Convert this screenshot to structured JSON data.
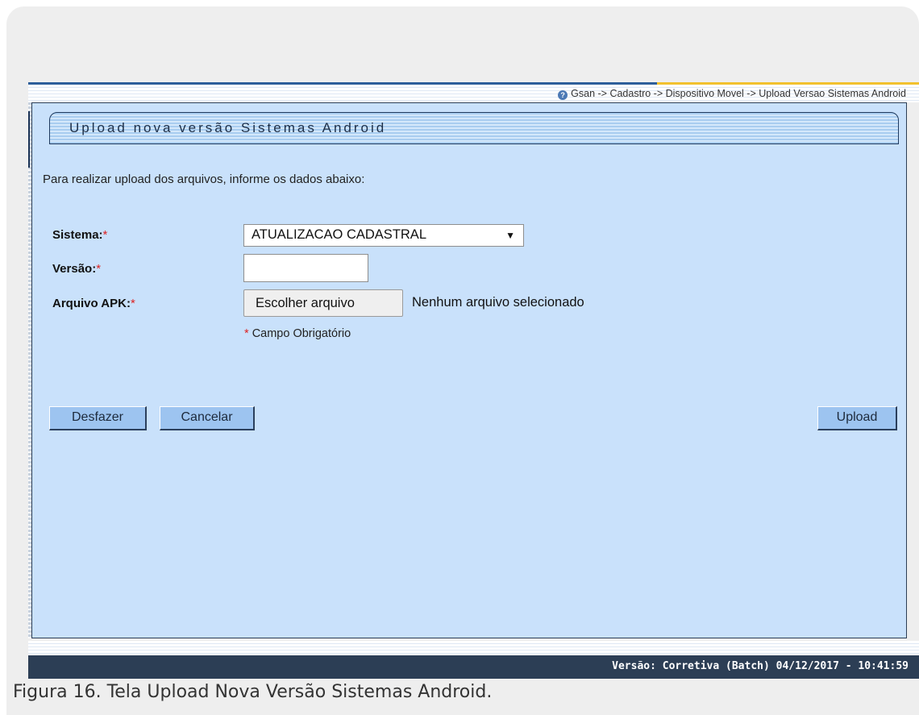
{
  "breadcrumb": "Gsan -> Cadastro -> Dispositivo Movel -> Upload Versao Sistemas Android",
  "page_title": "Upload nova versão Sistemas Android",
  "intro_text": "Para realizar upload dos arquivos, informe os dados abaixo:",
  "form": {
    "sistema_label": "Sistema:",
    "sistema_value": "ATUALIZACAO CADASTRAL",
    "versao_label": "Versão:",
    "versao_value": "",
    "arquivo_label": "Arquivo APK:",
    "file_button": "Escolher arquivo",
    "file_status": "Nenhum arquivo selecionado",
    "required_marker": "*",
    "required_note": "Campo Obrigatório"
  },
  "buttons": {
    "desfazer": "Desfazer",
    "cancelar": "Cancelar",
    "upload": "Upload"
  },
  "footer_version": "Versão: Corretiva (Batch) 04/12/2017 - 10:41:59",
  "caption": "Figura 16. Tela Upload Nova Versão Sistemas Android.",
  "icons": {
    "help": "help-icon",
    "dropdown": "chevron-down-icon"
  },
  "colors": {
    "panel": "#c9e1fb",
    "footer": "#2c3e55",
    "button": "#9dc4f0",
    "required": "#d22222"
  }
}
